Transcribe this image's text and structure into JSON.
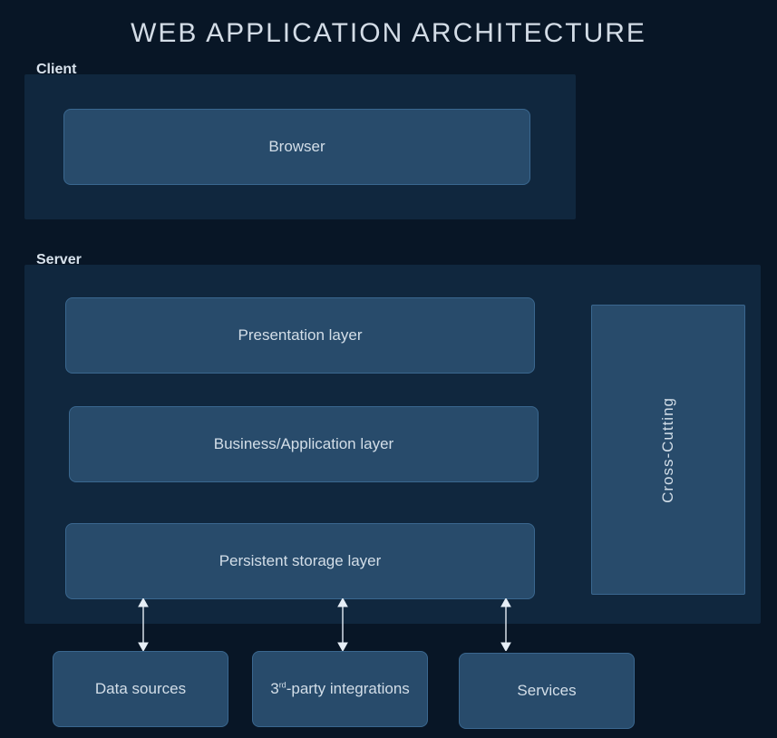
{
  "title": "WEB APPLICATION ARCHITECTURE",
  "sections": {
    "client": "Client",
    "server": "Server"
  },
  "boxes": {
    "browser": "Browser",
    "presentation": "Presentation layer",
    "business": "Business/Application layer",
    "storage": "Persistent storage layer",
    "cross": "Cross-Cutting",
    "data": "Data sources",
    "thirdparty_pre": "3",
    "thirdparty_sup": "rd",
    "thirdparty_post": "-party integrations",
    "services": "Services"
  }
}
